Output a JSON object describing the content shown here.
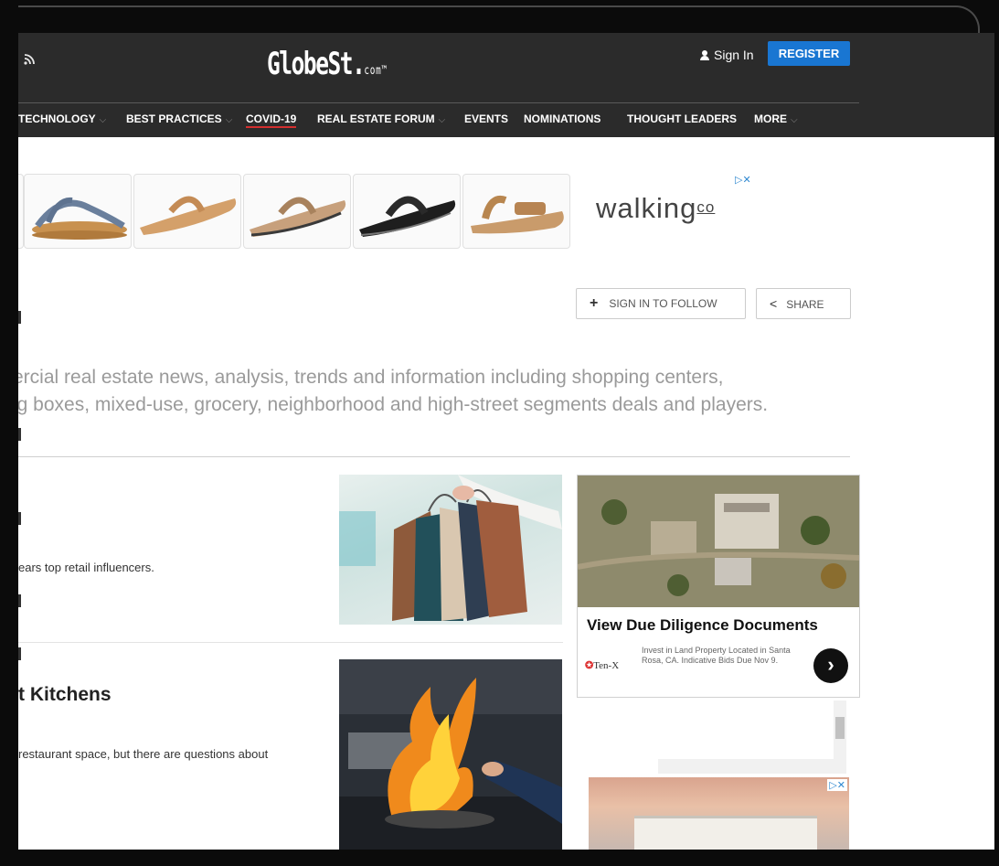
{
  "header": {
    "rss_icon": "rss-icon",
    "logo_main": "GlobeSt",
    "logo_dot": ".",
    "logo_suffix": "com",
    "logo_tm": "™",
    "sign_in": "Sign In",
    "register": "REGISTER"
  },
  "nav": {
    "items": [
      {
        "label": "TECHNOLOGY",
        "chevron": true
      },
      {
        "label": "BEST PRACTICES",
        "chevron": true
      },
      {
        "label": "COVID-19",
        "chevron": false,
        "active": true
      },
      {
        "label": "REAL ESTATE FORUM",
        "chevron": true
      },
      {
        "label": "EVENTS",
        "chevron": false
      },
      {
        "label": "NOMINATIONS",
        "chevron": false
      },
      {
        "label": "THOUGHT LEADERS",
        "chevron": false
      },
      {
        "label": "MORE",
        "chevron": true
      }
    ]
  },
  "top_ad": {
    "brand": "walking",
    "brand_suffix": "co",
    "adchoice": "▷✕"
  },
  "actions": {
    "follow": "SIGN IN TO FOLLOW",
    "share": "SHARE"
  },
  "description": {
    "line1": "ercial real estate news, analysis, trends and information including shopping centers,",
    "line2": "ig boxes, mixed-use, grocery, neighborhood and high-street segments deals and players."
  },
  "articles": [
    {
      "snippet": "ears top retail influencers."
    },
    {
      "title": "t Kitchens",
      "snippet": "restaurant space, but there are questions about"
    }
  ],
  "side_ad": {
    "title": "View Due Diligence Documents",
    "sponsor": "Ten-X",
    "body": "Invest in Land Property Located in Santa Rosa, CA. Indicative Bids Due Nov 9.",
    "arrow": "›"
  },
  "bottom_ad": {
    "adchoice": "▷✕"
  },
  "colors": {
    "header_bg": "#2b2b2b",
    "register_bg": "#1976d2",
    "active_underline": "#d32f2f"
  }
}
